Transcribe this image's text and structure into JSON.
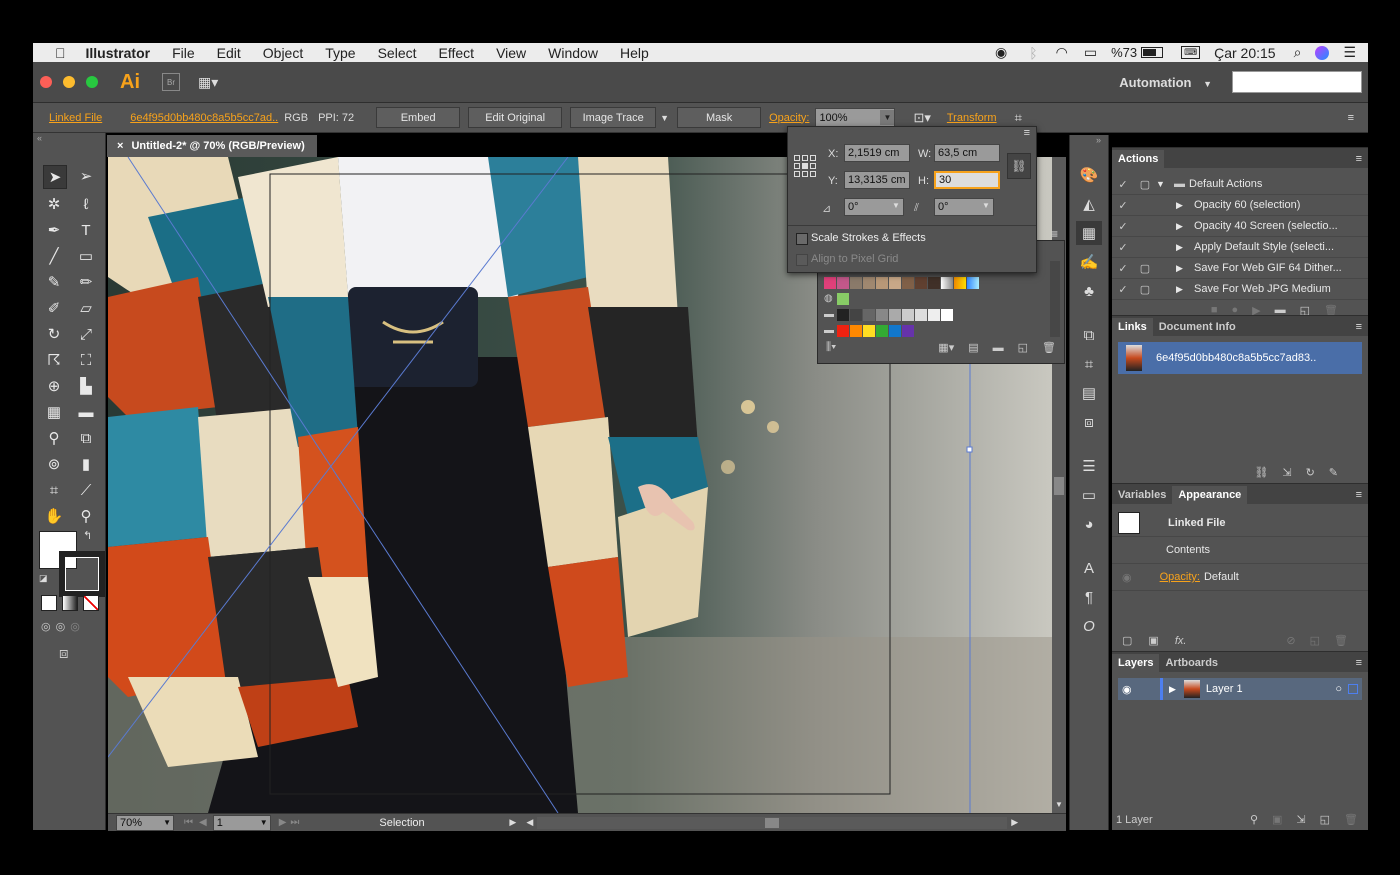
{
  "menubar": {
    "apple": "",
    "app_name": "Illustrator",
    "items": [
      "File",
      "Edit",
      "Object",
      "Type",
      "Select",
      "Effect",
      "View",
      "Window",
      "Help"
    ],
    "battery": "%73",
    "clock": "Çar 20:15"
  },
  "appbar": {
    "logo": "Ai",
    "bridge": "Br",
    "workspace": "Automation"
  },
  "controlbar": {
    "linked_file": "Linked File",
    "filename": "6e4f95d0bb480c8a5b5cc7ad..",
    "color_mode": "RGB",
    "ppi": "PPI: 72",
    "embed": "Embed",
    "edit_original": "Edit Original",
    "image_trace": "Image Trace",
    "mask": "Mask",
    "opacity_label": "Opacity:",
    "opacity_value": "100%",
    "transform": "Transform"
  },
  "document": {
    "tab_title": "Untitled-2* @ 70% (RGB/Preview)"
  },
  "transform": {
    "x_label": "X:",
    "x": "2,1519 cm",
    "y_label": "Y:",
    "y": "13,3135 cm",
    "w_label": "W:",
    "w": "63,5 cm",
    "h_label": "H:",
    "h": "30",
    "rotate": "0°",
    "shear": "0°",
    "scale_strokes": "Scale Strokes & Effects",
    "align_pixel": "Align to Pixel Grid"
  },
  "statusbar": {
    "zoom": "70%",
    "artboard": "1",
    "mode": "Selection"
  },
  "actions": {
    "tab": "Actions",
    "items": [
      {
        "label": "Default Actions",
        "type": "set"
      },
      {
        "label": "Opacity 60 (selection)",
        "type": "action"
      },
      {
        "label": "Opacity 40 Screen (selectio...",
        "type": "action"
      },
      {
        "label": "Apply Default Style (selecti...",
        "type": "action"
      },
      {
        "label": "Save For Web GIF 64 Dither...",
        "type": "action"
      },
      {
        "label": "Save For Web JPG Medium",
        "type": "action"
      }
    ]
  },
  "links": {
    "tabs": [
      "Links",
      "Document Info"
    ],
    "item": "6e4f95d0bb480c8a5b5cc7ad83.."
  },
  "appearance": {
    "tabs": [
      "Variables",
      "Appearance"
    ],
    "title": "Linked File",
    "contents": "Contents",
    "opacity_label": "Opacity:",
    "opacity_value": "Default",
    "fx": "fx."
  },
  "layers": {
    "tabs": [
      "Layers",
      "Artboards"
    ],
    "layer": "Layer 1",
    "count": "1 Layer"
  },
  "colors": {
    "accent": "#f7a21b",
    "panel": "#535353",
    "selection_blue": "#4a6ea8"
  }
}
